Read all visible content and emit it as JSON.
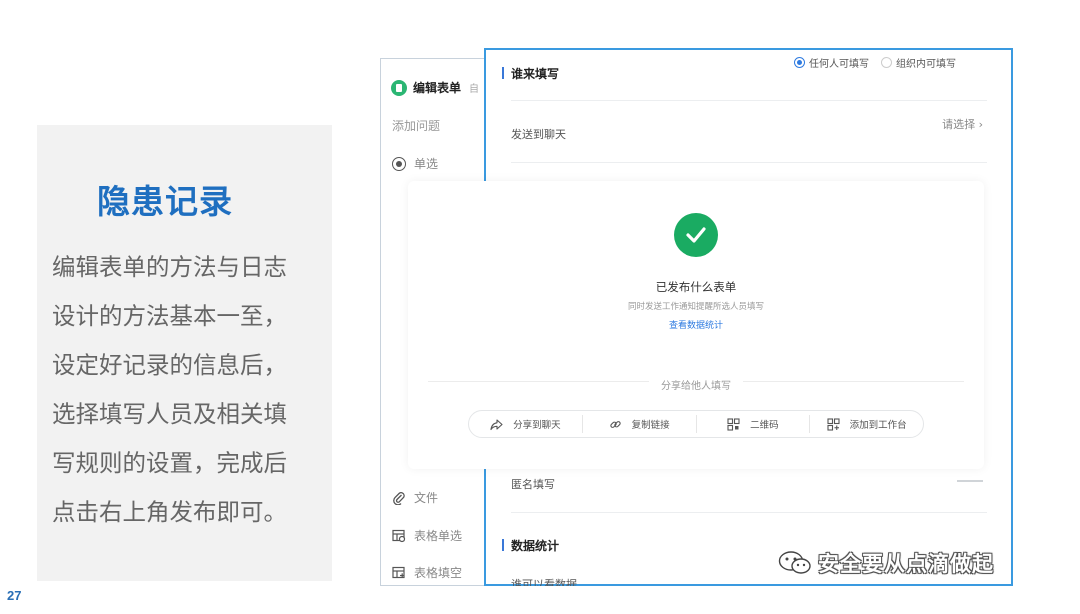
{
  "slide": {
    "title": "隐患记录",
    "body_lines": [
      "编辑表单的方法与日志",
      "设计的方法基本一至，",
      "设定好记录的信息后，",
      "选择填写人员及相关填",
      "写规则的设置，完成后",
      "点击右上角发布即可。"
    ],
    "page_number": "27"
  },
  "editor": {
    "header_title": "编辑表单",
    "header_truncated": "自",
    "add_question": "添加问题",
    "items": [
      {
        "label": "单选",
        "icon": "radio-icon"
      },
      {
        "label": "文件",
        "icon": "paperclip-icon"
      },
      {
        "label": "表格单选",
        "icon": "table-radio-icon"
      },
      {
        "label": "表格填空",
        "icon": "table-fill-icon"
      }
    ]
  },
  "settings": {
    "section_who": "谁来填写",
    "radio_options": [
      "任何人可填写",
      "组织内可填写"
    ],
    "radio_selected": "任何人可填写",
    "send_to_chat": "发送到聊天",
    "choose_label": "请选择 ›",
    "signed_fill": "匿名填写",
    "section_stats": "数据统计",
    "who_can_view": "谁可以看数据"
  },
  "modal": {
    "icon": "check-circle-icon",
    "title": "已发布什么表单",
    "subtitle": "同时发送工作通知提醒所选人员填写",
    "link": "查看数据统计",
    "share_label": "分享给他人填写",
    "share_buttons": [
      {
        "label": "分享到聊天",
        "icon": "share-icon"
      },
      {
        "label": "复制链接",
        "icon": "link-icon"
      },
      {
        "label": "二维码",
        "icon": "qrcode-icon"
      },
      {
        "label": "添加到工作台",
        "icon": "add-workbench-icon"
      }
    ]
  },
  "watermark": {
    "text": "安全要从点滴做起",
    "icon": "wechat-icon"
  },
  "colors": {
    "title_blue": "#1f6fc0",
    "frame_blue": "#3a9ae0",
    "success_green": "#1aab62",
    "link_blue": "#2f7be0"
  }
}
